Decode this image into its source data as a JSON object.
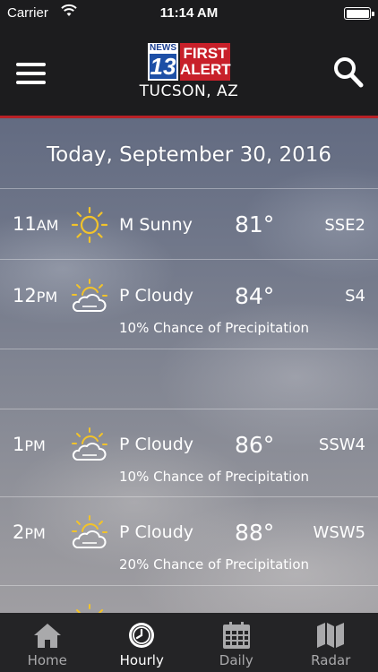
{
  "status_bar": {
    "carrier": "Carrier",
    "time": "11:14 AM"
  },
  "header": {
    "logo": {
      "news": "NEWS",
      "channel": "13",
      "brand_line1": "FIRST",
      "brand_line2": "ALERT"
    },
    "location": "TUCSON, AZ",
    "accent_color": "#b82127"
  },
  "date": "Today, September 30, 2016",
  "hours": [
    {
      "hour": "11",
      "ampm": "AM",
      "icon": "sun-icon",
      "condition": "M Sunny",
      "temp": "81°",
      "wind": "SSE2",
      "precip": ""
    },
    {
      "hour": "12",
      "ampm": "PM",
      "icon": "partly-cloudy-icon",
      "condition": "P Cloudy",
      "temp": "84°",
      "wind": "S4",
      "precip": "10% Chance of Precipitation"
    },
    {
      "hour": "1",
      "ampm": "PM",
      "icon": "partly-cloudy-icon",
      "condition": "P Cloudy",
      "temp": "86°",
      "wind": "SSW4",
      "precip": "10% Chance of Precipitation"
    },
    {
      "hour": "2",
      "ampm": "PM",
      "icon": "partly-cloudy-icon",
      "condition": "P Cloudy",
      "temp": "88°",
      "wind": "WSW5",
      "precip": "20% Chance of Precipitation"
    }
  ],
  "tabs": [
    {
      "label": "Home",
      "icon": "home-icon",
      "active": false
    },
    {
      "label": "Hourly",
      "icon": "clock-icon",
      "active": true
    },
    {
      "label": "Daily",
      "icon": "calendar-icon",
      "active": false
    },
    {
      "label": "Radar",
      "icon": "map-icon",
      "active": false
    }
  ]
}
